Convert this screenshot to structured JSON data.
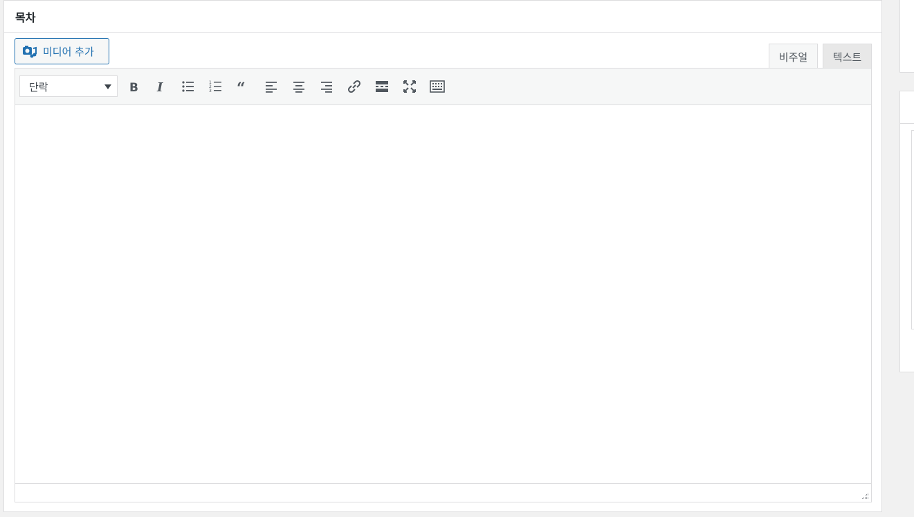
{
  "panel": {
    "title": "목차",
    "media_button_label": "미디어 추가",
    "tabs": [
      {
        "label": "비주얼",
        "active": true
      },
      {
        "label": "텍스트",
        "active": false
      }
    ],
    "toolbar": {
      "format_value": "단락",
      "buttons": [
        "bold",
        "italic",
        "bulleted-list",
        "numbered-list",
        "blockquote",
        "align-left",
        "align-center",
        "align-right",
        "link",
        "read-more",
        "fullscreen",
        "toolbar-toggle"
      ]
    },
    "content": ""
  },
  "colors": {
    "accent": "#2271b1",
    "border": "#dcdcde",
    "toolbar_bg": "#f6f7f7",
    "icon": "#50575e",
    "background": "#f1f1f1"
  }
}
